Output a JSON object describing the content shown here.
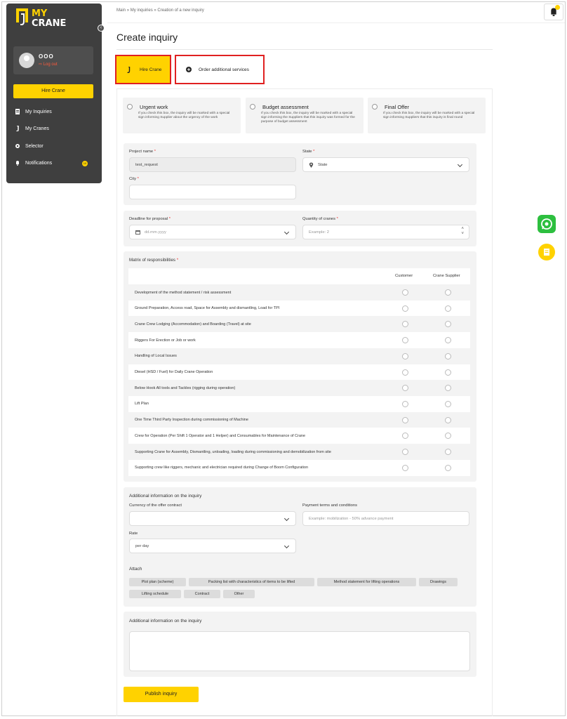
{
  "sidebar": {
    "logo_top": "MY",
    "logo_bottom": "CRANE",
    "user_name": "ООО",
    "logout": "Log out",
    "hire_button": "Hire Crane",
    "items": [
      {
        "label": "My Inquiries",
        "icon": "document-icon"
      },
      {
        "label": "My Cranes",
        "icon": "hook-icon"
      },
      {
        "label": "Selector",
        "icon": "gear-icon"
      },
      {
        "label": "Notifications",
        "icon": "bell-icon"
      }
    ],
    "notifications_badge": "10"
  },
  "breadcrumb": {
    "items": [
      "Main",
      "»",
      "My inquiries",
      "»",
      "Creation of a new inquiry"
    ]
  },
  "page": {
    "title": "Create inquiry"
  },
  "tabs": {
    "hire": "Hire Crane",
    "order": "Order additional services"
  },
  "options": [
    {
      "title": "Urgent work",
      "desc": "If you check this box, the inquiry will be marked with a special sign informing Supplier about the urgency of the work"
    },
    {
      "title": "Budget assessment",
      "desc": "If you check this box, the inquiry will be marked with a special sign informing the Suppliers that this inquiry was formed for the purpose of budget assessment"
    },
    {
      "title": "Final Offer",
      "desc": "If you check this box, the inquiry will be marked with a special sign informing Suppliers that this inquiry is final round"
    }
  ],
  "project": {
    "name_label": "Project name",
    "name_value": "test_request",
    "state_label": "State",
    "state_value": "State",
    "city_label": "City",
    "city_value": "",
    "required_mark": "*"
  },
  "deadline": {
    "label": "Deadline for proposal",
    "placeholder": "dd.mm.yyyy",
    "quantity_label": "Quantity of cranes",
    "quantity_placeholder": "Example: 2"
  },
  "matrix": {
    "title": "Matrix of responsibilities",
    "col_customer": "Customer",
    "col_supplier": "Crane Supplier",
    "rows": [
      "Development of the method statement / risk assessment",
      "Ground Preparation, Access road, Space for Assembly and dismantling, Load for TPI",
      "Crane Crew Lodging (Accommodation) and Boarding (Travel) at site",
      "Riggers For Erection or Job or work",
      "Handling of Local Issues",
      "Diesel (HSD / Fuel) for Daily Crane Operation",
      "Below Hook All tools and Tackles (rigging during operation)",
      "Lift Plan",
      "One Time Third Party Inspection during commissioning of Machine",
      "Crew for Operation (Per Shift 1 Operator and 1 Helper) and Consumables for Maintenance of Crane",
      "Supporting Crane for Assembly, Dismantling, unloading, loading during commissioning and demobilization from site",
      "Supporting crew like riggers, mechanic and electrician required during Change of Boom Configuration"
    ]
  },
  "additional": {
    "title": "Additional information on the inquiry",
    "currency_label": "Currency of the offer contract",
    "currency_value": "",
    "payment_label": "Payment terms and conditions",
    "payment_placeholder": "Example: mobilization - 50% advance payment",
    "rate_label": "Rate",
    "rate_value": "per day",
    "attach_label": "Attach",
    "attachments": [
      "Plot plan (scheme)",
      "Packing list with characteristics of items to be lifted",
      "Method statement for lifting operations",
      "Drawings",
      "Lifting schedule",
      "Contract",
      "Other"
    ]
  },
  "notes": {
    "title": "Additional information on the inquiry"
  },
  "publish_button": "Publish inquiry",
  "colors": {
    "accent": "#ffd200",
    "sidebar_bg": "#3f3f3f",
    "highlight_border": "#e02020",
    "whatsapp": "#2dbf3f"
  }
}
